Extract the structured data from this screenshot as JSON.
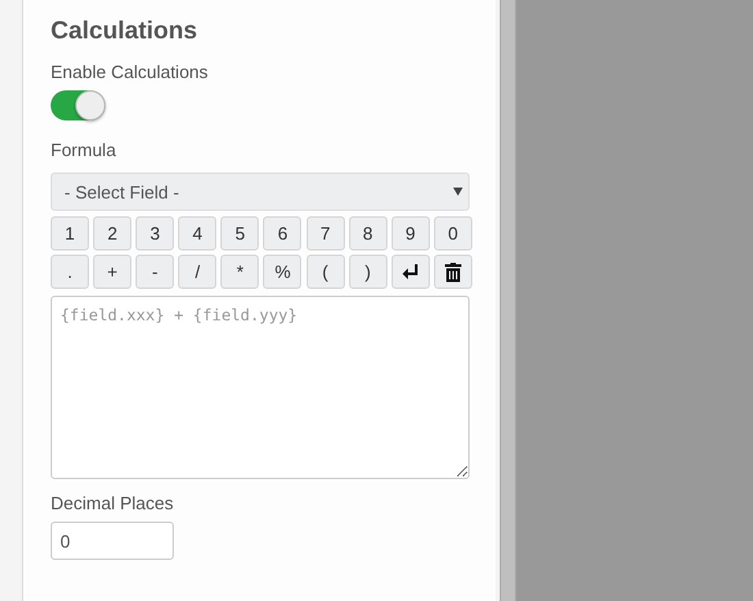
{
  "section": {
    "title": "Calculations"
  },
  "enable": {
    "label": "Enable Calculations",
    "on": true
  },
  "formula": {
    "label": "Formula",
    "select_placeholder": "- Select Field -",
    "keys": [
      {
        "kind": "text",
        "label": "1"
      },
      {
        "kind": "text",
        "label": "2"
      },
      {
        "kind": "text",
        "label": "3"
      },
      {
        "kind": "text",
        "label": "4"
      },
      {
        "kind": "text",
        "label": "5"
      },
      {
        "kind": "text",
        "label": "6"
      },
      {
        "kind": "text",
        "label": "7"
      },
      {
        "kind": "text",
        "label": "8"
      },
      {
        "kind": "text",
        "label": "9"
      },
      {
        "kind": "text",
        "label": "0"
      },
      {
        "kind": "text",
        "label": "."
      },
      {
        "kind": "text",
        "label": "+"
      },
      {
        "kind": "text",
        "label": "-"
      },
      {
        "kind": "text",
        "label": "/"
      },
      {
        "kind": "text",
        "label": "*"
      },
      {
        "kind": "text",
        "label": "%"
      },
      {
        "kind": "text",
        "label": "("
      },
      {
        "kind": "text",
        "label": ")"
      },
      {
        "kind": "enter"
      },
      {
        "kind": "delete"
      }
    ],
    "placeholder": "{field.xxx} + {field.yyy}"
  },
  "decimal_places": {
    "label": "Decimal Places",
    "value": "0"
  }
}
